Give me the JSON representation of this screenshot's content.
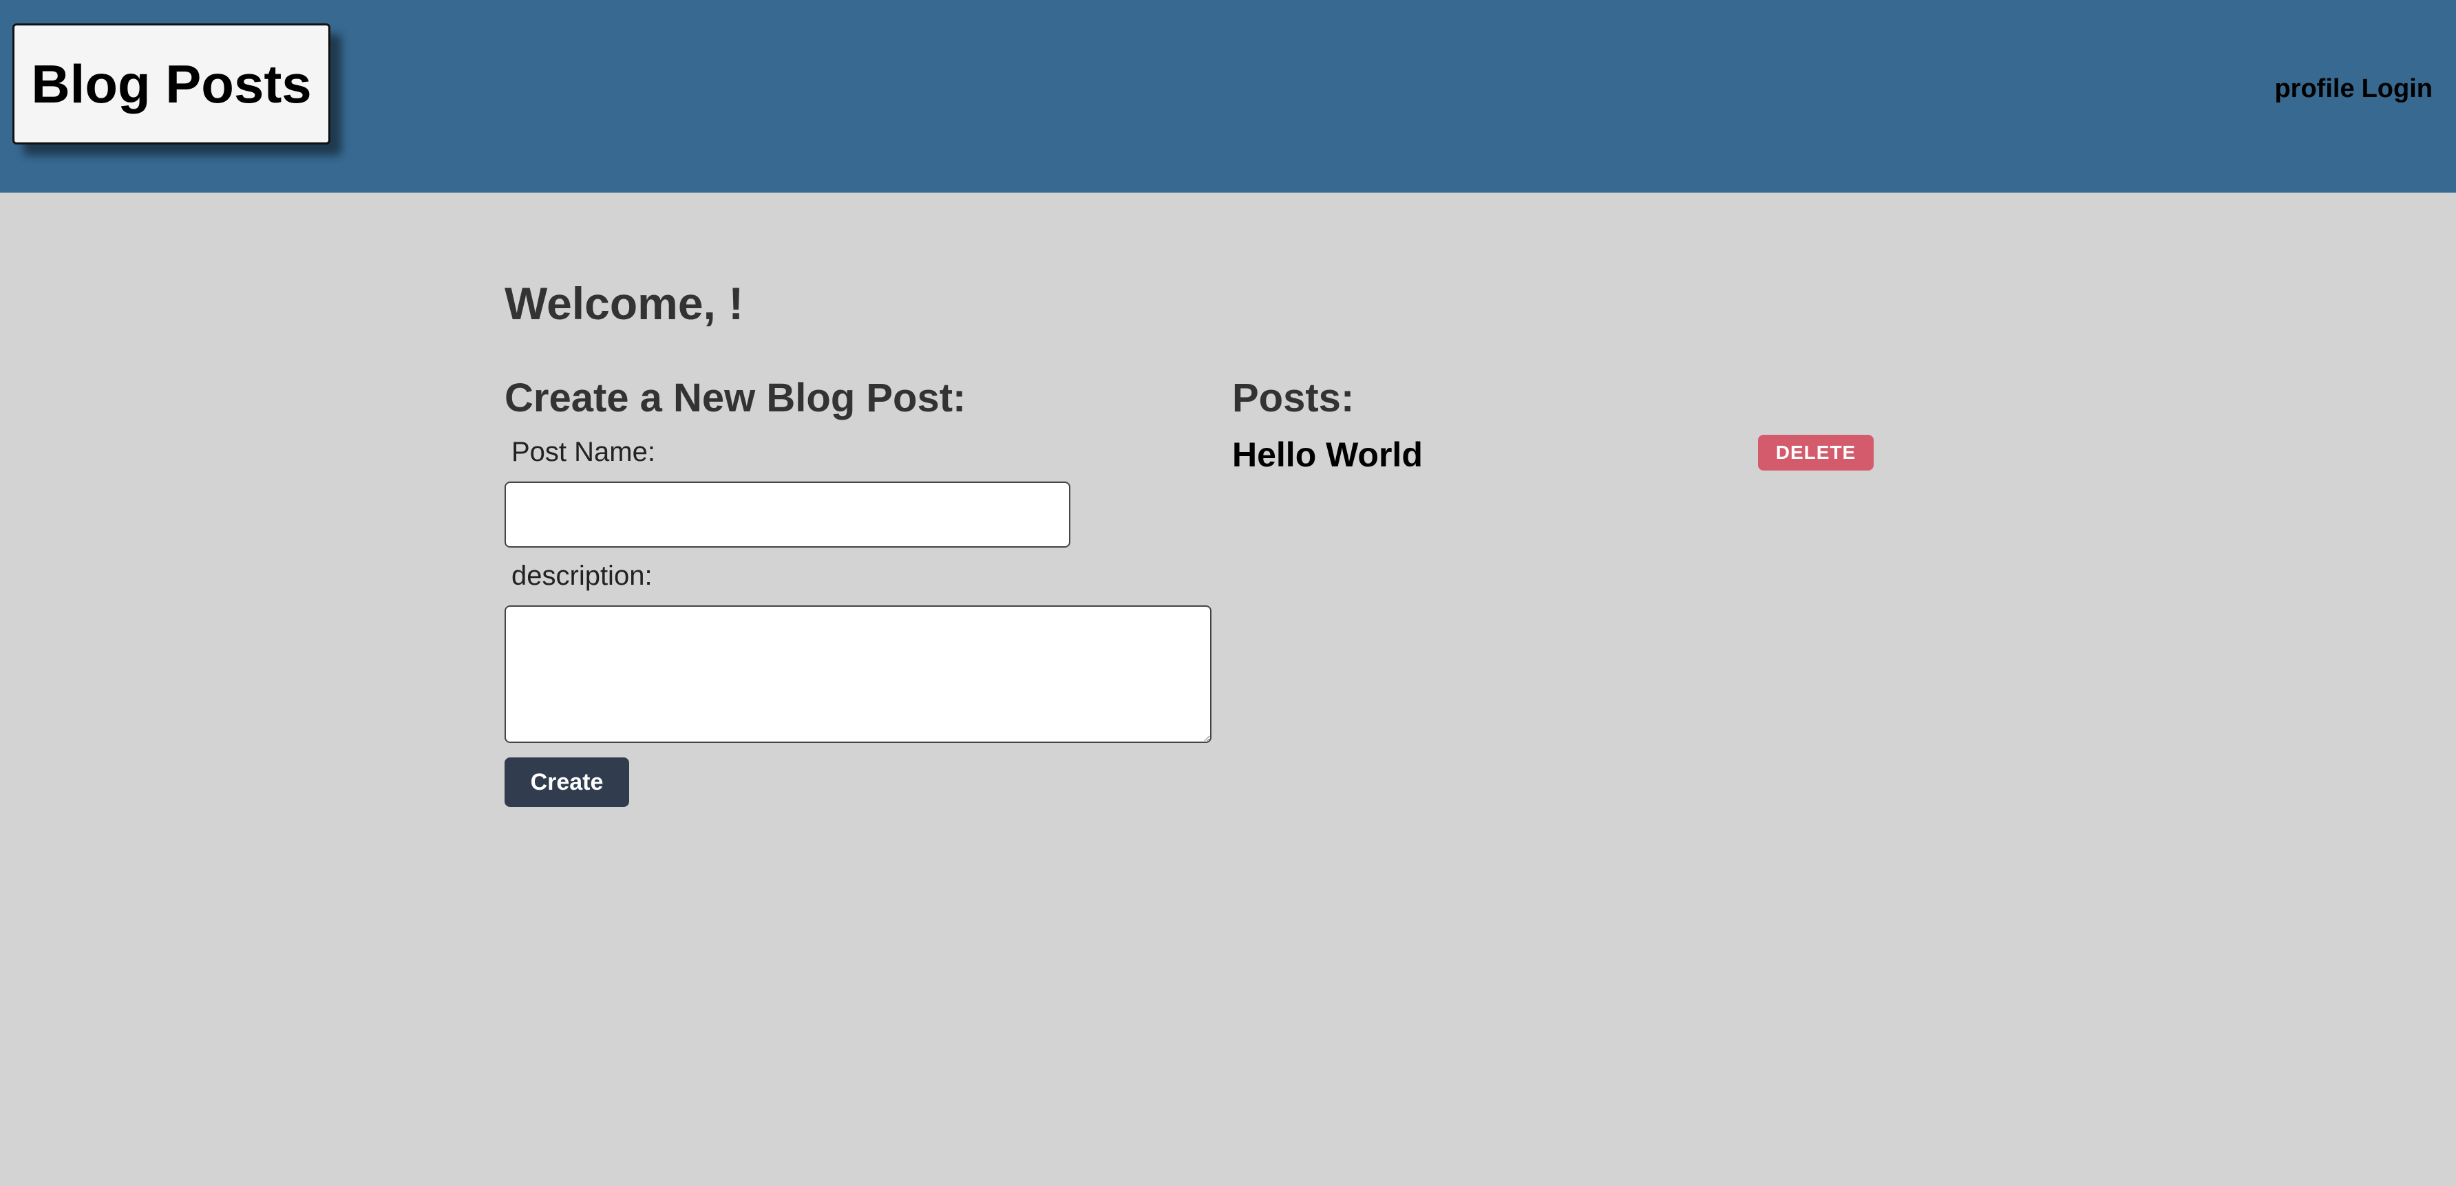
{
  "header": {
    "brand": "Blog Posts",
    "nav": {
      "profile": "profile",
      "login": "Login"
    },
    "background_color": "#376991"
  },
  "main": {
    "welcome": "Welcome, !",
    "create_form": {
      "title": "Create a New Blog Post:",
      "name_label": "Post Name:",
      "name_value": "",
      "description_label": "description:",
      "description_value": "",
      "submit_label": "Create"
    },
    "posts": {
      "title": "Posts:",
      "items": [
        {
          "title": "Hello World",
          "delete_label": "DELETE"
        }
      ]
    }
  },
  "colors": {
    "page_background": "#d3d3d3",
    "create_button": "#313d4f",
    "delete_button": "#d45b6c"
  }
}
